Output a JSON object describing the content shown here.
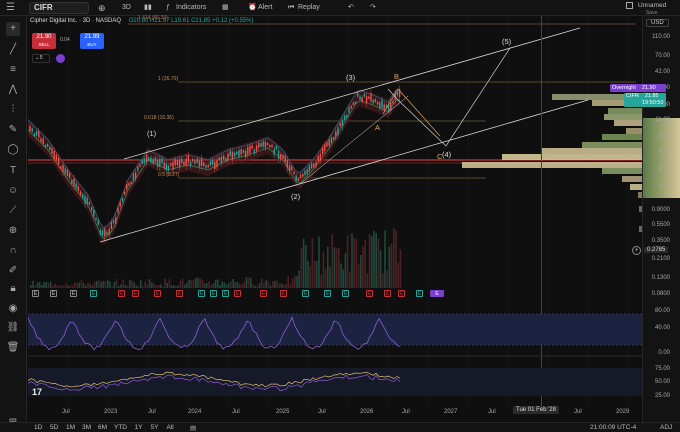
{
  "topbar": {
    "symbol": "CIFR",
    "timeframe": "3D",
    "indicators": "Indicators",
    "alert": "Alert",
    "replay": "Replay",
    "layout_name": "Unnamed",
    "save": "Save"
  },
  "legend": {
    "title": "Cipher Digital Inc. · 3D · NASDAQ",
    "ohlc": "O20.80 H21.97 L19.61 C21.85 +0.12 (+0.55%)",
    "sell_price": "21.90",
    "sell_label": "SELL",
    "spread": "0.04",
    "buy_price": "21.99",
    "buy_label": "BUY",
    "indicator_count": "5",
    "top_mark": "1.414 (66.33)"
  },
  "price_axis": {
    "currency": "USD",
    "ticks": [
      "110.00",
      "70.00",
      "42.00",
      "27.00",
      "17.00",
      "11.00",
      "7.00",
      "4.50",
      "2.50",
      "1.50",
      "0.9000",
      "0.5500",
      "0.3500",
      "0.2100",
      "0.1300",
      "0.0800"
    ],
    "low_label": "0.2785",
    "overnight_label": "Overnight",
    "overnight_value": "21.90",
    "ticker_label": "CIFR",
    "ticker_value": "21.85",
    "countdown": "19:50:50",
    "rsi_ticks": [
      "80.00",
      "40.00",
      "0.00"
    ],
    "stoch_ticks": [
      "75.00",
      "50.00",
      "25.00"
    ]
  },
  "fib_labels": [
    "1 (26.70)",
    "0.618 (10.36)",
    "0.5 (8.27)"
  ],
  "wave_labels": [
    "(1)",
    "(2)",
    "(3)",
    "(4)",
    "(5)",
    "A",
    "B",
    "C"
  ],
  "time_axis": {
    "ticks": [
      "Jul",
      "2023",
      "Jul",
      "2024",
      "Jul",
      "2025",
      "Jul",
      "2026",
      "Jul",
      "2027",
      "Jul",
      "2028",
      "Jul",
      "2029"
    ],
    "cursor": "Tue 01 Feb '28"
  },
  "bottombar": {
    "ranges": [
      "1D",
      "5D",
      "1M",
      "3M",
      "6M",
      "YTD",
      "1Y",
      "5Y",
      "All"
    ],
    "clock": "21:00:09 UTC-4",
    "adj": "ADJ"
  },
  "indicator_icons": [
    "E",
    "E",
    "E",
    "E",
    "E",
    "E",
    "E",
    "E",
    "E",
    "E",
    "E",
    "E",
    "E",
    "E",
    "E",
    "E",
    "E",
    "E",
    "E",
    "E",
    "E",
    "E"
  ],
  "colors": {
    "bg": "#0f0f0f",
    "sell": "#c62f3a",
    "buy": "#2962ff",
    "overnight": "#7b3fd0",
    "ticker": "#26a69a",
    "rsi_line": "#8e5cd8",
    "stoch": "#e0c070",
    "channel": "#d8d8d8",
    "fib_red": "#c73a3a"
  }
}
